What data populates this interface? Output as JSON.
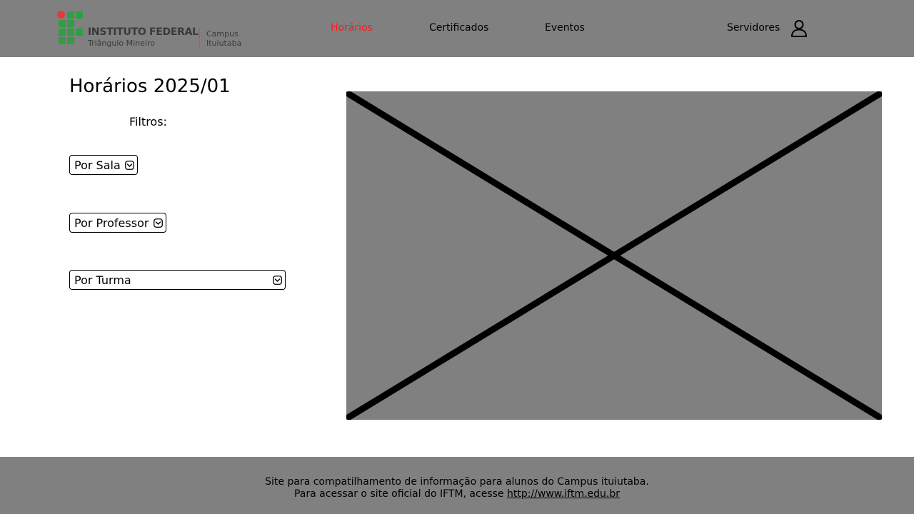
{
  "logo": {
    "name": "INSTITUTO FEDERAL",
    "subtitle": "Triângulo Mineiro",
    "campus_line1": "Campus",
    "campus_line2": "Ituiutaba",
    "dot_color": "#e03a3e",
    "square_color": "#2f9e44"
  },
  "nav": {
    "items": [
      {
        "label": "Horários",
        "active": true
      },
      {
        "label": "Certificados",
        "active": false
      },
      {
        "label": "Eventos",
        "active": false
      }
    ],
    "active_color": "#ff1a1a",
    "servidores_label": "Servidores",
    "user_icon": "user-icon"
  },
  "main": {
    "title": "Horários 2025/01",
    "filters_label": "Filtros:",
    "selects": [
      {
        "label": "Por Sala",
        "icon": "chevron-down-icon"
      },
      {
        "label": "Por Professor",
        "icon": "chevron-down-icon"
      },
      {
        "label": "Por Turma",
        "icon": "chevron-down-icon"
      }
    ],
    "image_placeholder": {
      "fill_color": "#808080",
      "icon": "image-placeholder-cross"
    }
  },
  "footer": {
    "line1": "Site para compatilhamento de informação para alunos do Campus ituiutaba.",
    "line2_prefix": "Para acessar o site oficial do IFTM, acesse ",
    "link_text": "http://www.iftm.edu.br"
  },
  "colors": {
    "header_bg": "#808080",
    "footer_bg": "#808080",
    "page_bg": "#ffffff"
  }
}
